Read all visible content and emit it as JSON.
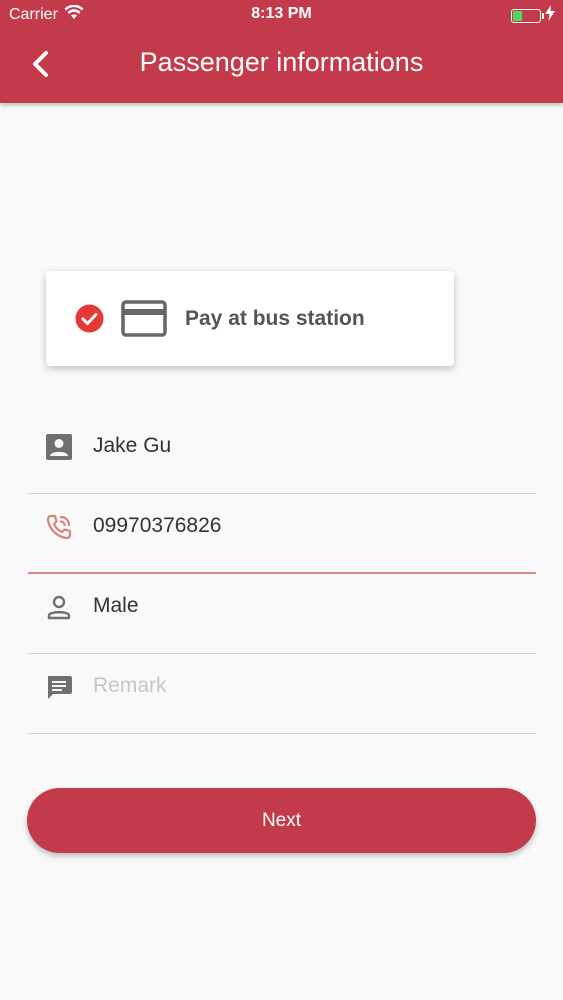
{
  "status_bar": {
    "carrier": "Carrier",
    "time": "8:13 PM"
  },
  "header": {
    "title": "Passenger informations",
    "back_icon": "chevron-left-icon"
  },
  "payment": {
    "label": "Pay at bus station",
    "selected": true,
    "check_icon": "check-circle-icon",
    "method_icon": "credit-card-icon"
  },
  "form": {
    "name": {
      "value": "Jake Gu",
      "icon": "contact-card-icon"
    },
    "phone": {
      "value": "09970376826",
      "icon": "phone-ringing-icon"
    },
    "gender": {
      "value": "Male",
      "icon": "person-outline-icon"
    },
    "remark": {
      "value": "",
      "placeholder": "Remark",
      "icon": "chat-bubble-icon"
    }
  },
  "actions": {
    "next_label": "Next"
  },
  "colors": {
    "primary": "#c33a4a",
    "check": "#e53935",
    "active_underline": "#d9877f",
    "phone_icon": "#d9827a",
    "icon_grey": "#707070",
    "battery": "#4cd964"
  }
}
